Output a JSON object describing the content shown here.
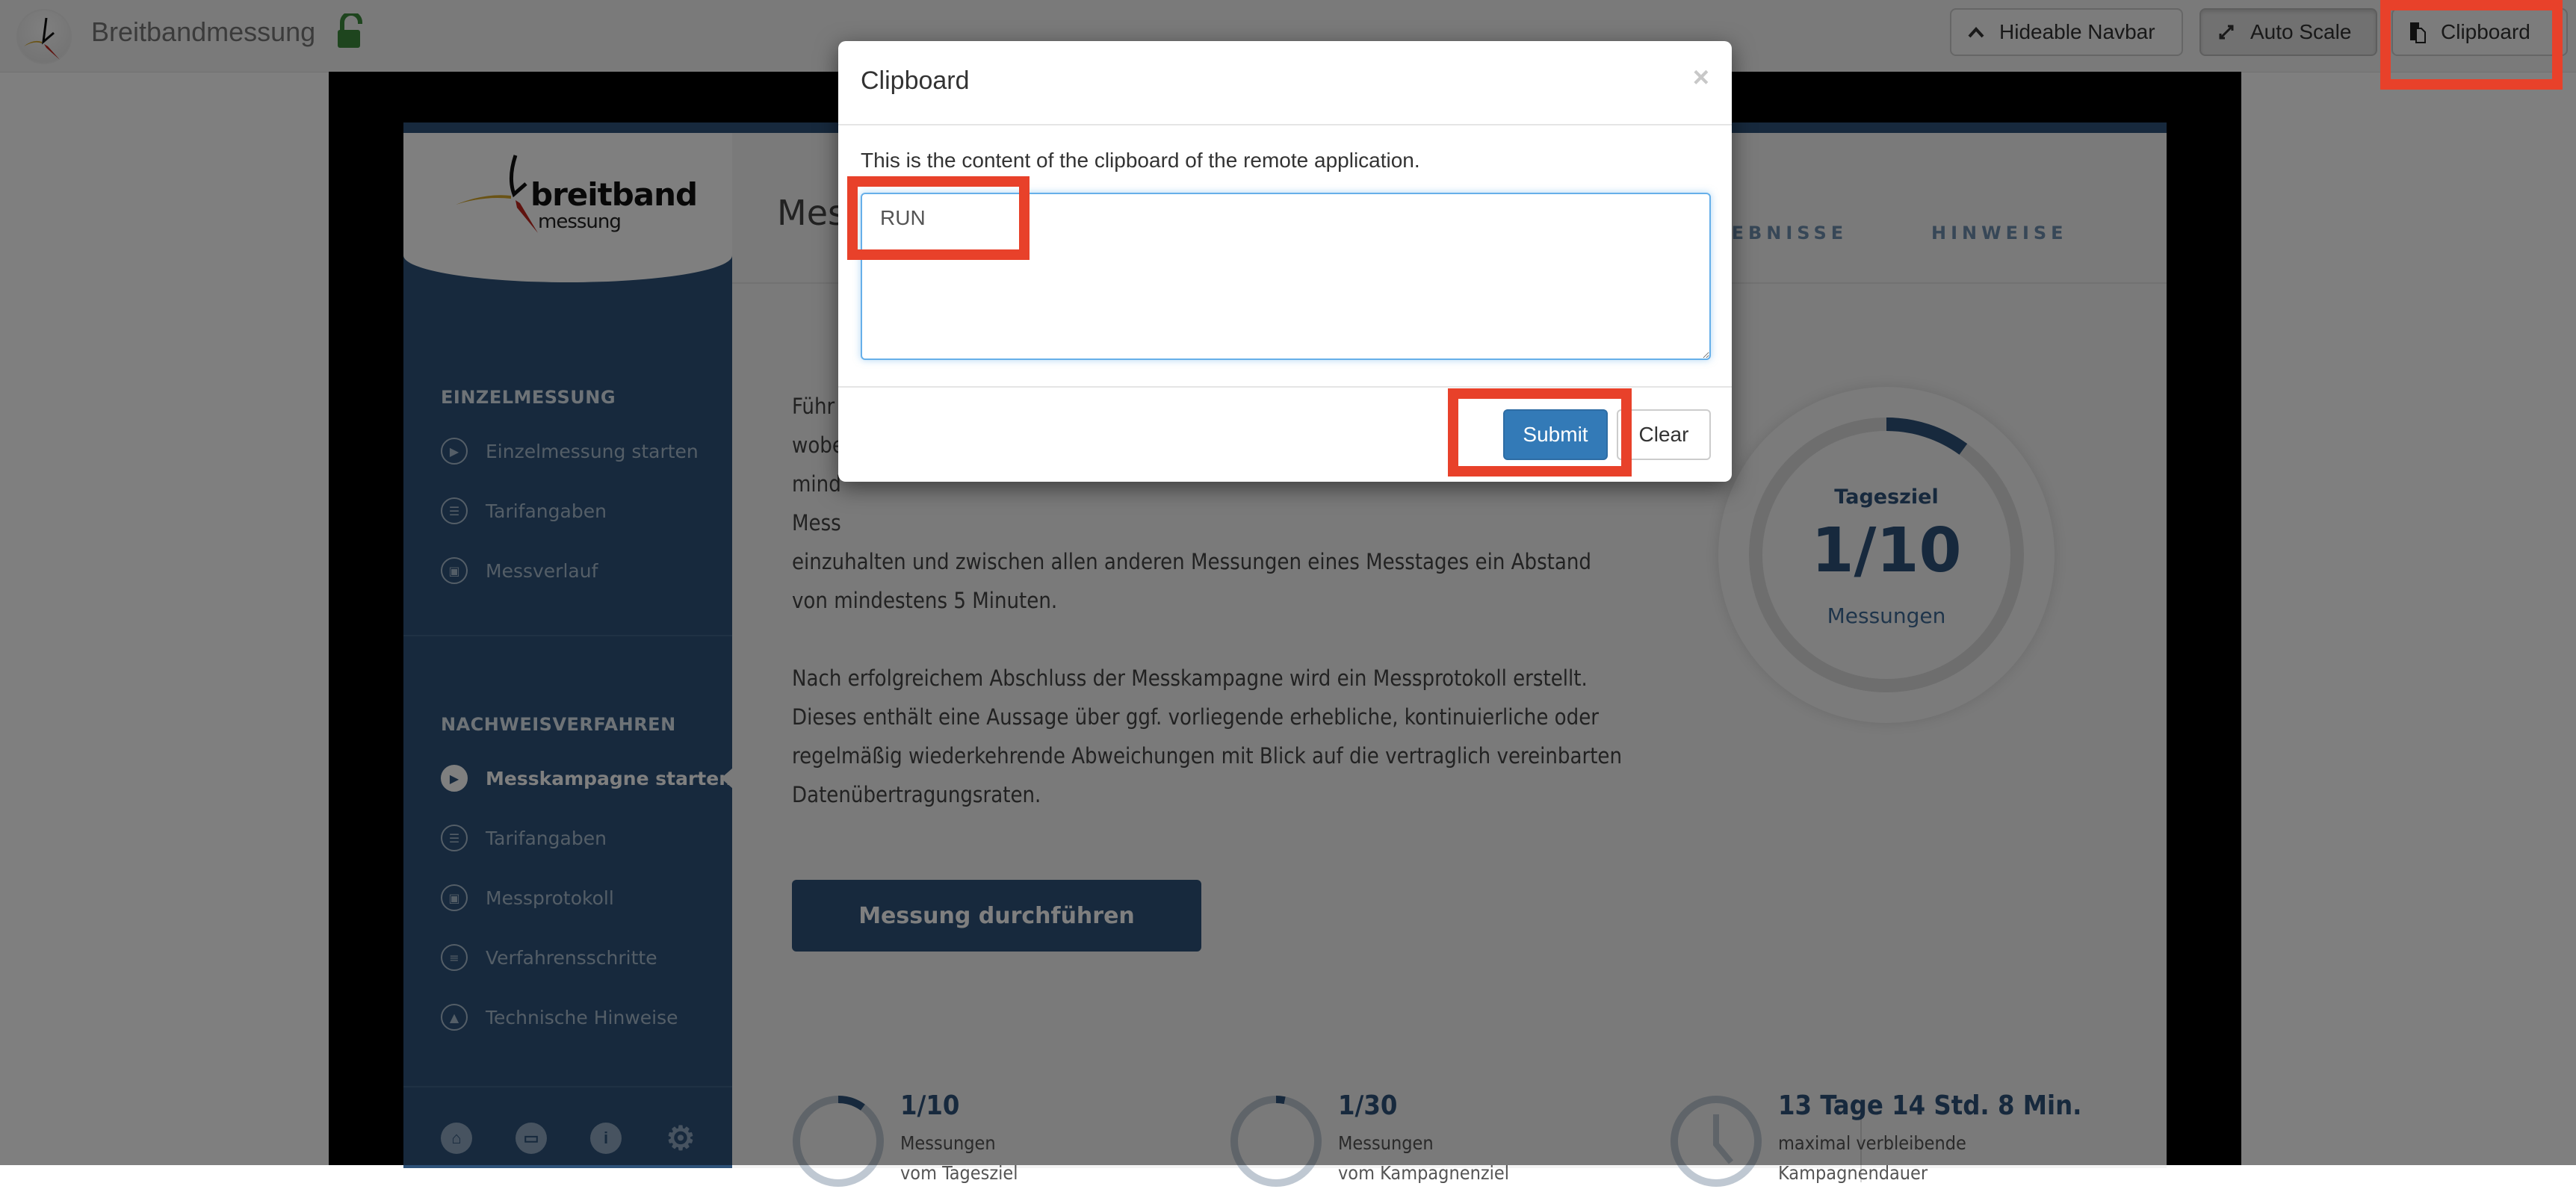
{
  "topbar": {
    "title": "Breitbandmessung",
    "lock_icon": "unlocked-padlock-icon",
    "buttons": [
      {
        "label": "Hideable Navbar",
        "icon": "chevron-up-icon"
      },
      {
        "label": "Auto Scale",
        "icon": "expand-arrows-icon"
      },
      {
        "label": "Clipboard",
        "icon": "clipboard-icon"
      }
    ]
  },
  "remote_app": {
    "brand": {
      "word": "breitband",
      "sub": "messung"
    },
    "sidebar": {
      "sections": [
        {
          "title": "EINZELMESSUNG",
          "items": [
            {
              "label": "Einzelmessung starten",
              "icon": "play-icon"
            },
            {
              "label": "Tarifangaben",
              "icon": "id-card-icon"
            },
            {
              "label": "Messverlauf",
              "icon": "clipboard-icon"
            }
          ]
        },
        {
          "title": "NACHWEISVERFAHREN",
          "items": [
            {
              "label": "Messkampagne starten",
              "icon": "play-icon",
              "active": true
            },
            {
              "label": "Tarifangaben",
              "icon": "id-card-icon"
            },
            {
              "label": "Messprotokoll",
              "icon": "clipboard-icon"
            },
            {
              "label": "Verfahrensschritte",
              "icon": "list-icon"
            },
            {
              "label": "Technische Hinweise",
              "icon": "warning-icon"
            }
          ]
        }
      ],
      "footer_icons": [
        "home-icon",
        "chat-icon",
        "info-icon",
        "gear-icon"
      ]
    },
    "heading": "Mes",
    "tabs": [
      "ERGEBNISSE",
      "HINWEISE"
    ],
    "paragraph_1_fragments": [
      "Führ",
      "wobe",
      "mind",
      "Mess"
    ],
    "paragraph_1_visible": [
      "einzuhalten und zwischen allen anderen Messungen eines Messtages ein Abstand",
      "von mindestens 5 Minuten."
    ],
    "paragraph_2": [
      "Nach erfolgreichem Abschluss der Messkampagne wird ein Messprotokoll erstellt.",
      "Dieses enthält eine Aussage über ggf. vorliegende erhebliche, kontinuierliche oder",
      "regelmäßig wiederkehrende Abweichungen mit Blick auf die vertraglich vereinbarten",
      "Datenübertragungsraten."
    ],
    "cta_label": "Messung durchführen",
    "daily_goal": {
      "title": "Tagesziel",
      "value": "1/10",
      "unit": "Messungen",
      "progress": 0.1
    },
    "stats": [
      {
        "value": "1/10",
        "line1": "Messungen",
        "line2": "vom Tagesziel",
        "progress": 0.1,
        "icon": "progress-ring"
      },
      {
        "value": "1/30",
        "line1": "Messungen",
        "line2": "vom Kampagnenziel",
        "progress": 0.0333,
        "icon": "progress-ring"
      },
      {
        "value": "13 Tage 14 Std. 8 Min.",
        "line1": "maximal verbleibende",
        "line2": "Kampagnendauer",
        "icon": "clock-icon"
      }
    ]
  },
  "modal": {
    "title": "Clipboard",
    "close_glyph": "×",
    "description": "This is the content of the clipboard of the remote application.",
    "textarea_value": "RUN",
    "submit_label": "Submit",
    "clear_label": "Clear"
  },
  "colors": {
    "brand_blue": "#2e527a",
    "primary_button": "#337ab7",
    "annotation_red": "#e8412a",
    "lock_green": "#3c8a3c"
  }
}
